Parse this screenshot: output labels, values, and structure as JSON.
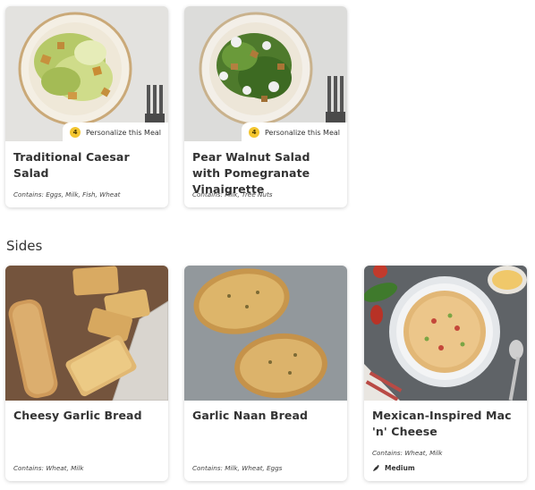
{
  "salads": [
    {
      "title": "Traditional Caesar Salad",
      "contains": "Contains: Eggs, Milk, Fish, Wheat",
      "personalize_count": "4",
      "personalize_label": "Personalize this Meal"
    },
    {
      "title": "Pear Walnut Salad with Pomegranate Vinaigrette",
      "contains": "Contains: Milk, Tree Nuts",
      "personalize_count": "4",
      "personalize_label": "Personalize this Meal"
    }
  ],
  "sides_heading": "Sides",
  "sides": [
    {
      "title": "Cheesy Garlic Bread",
      "contains": "Contains: Wheat, Milk"
    },
    {
      "title": "Garlic Naan Bread",
      "contains": "Contains: Milk, Wheat, Eggs"
    },
    {
      "title": "Mexican-Inspired Mac 'n' Cheese",
      "contains": "Contains: Wheat, Milk",
      "spice_level": "Medium",
      "spice_icon": "chili-pepper-icon"
    }
  ],
  "colors": {
    "badge": "#f3c52f",
    "card_bg": "#ffffff",
    "text": "#333333"
  }
}
